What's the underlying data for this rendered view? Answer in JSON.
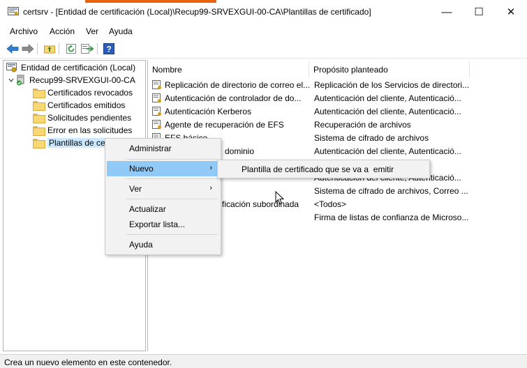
{
  "window": {
    "title": "certsrv - [Entidad de certificación (Local)\\Recup99-SRVEXGUI-00-CA\\Plantillas de certificado]",
    "minimize_glyph": "—",
    "maximize_glyph": "☐",
    "close_glyph": "✕"
  },
  "menubar": {
    "items": [
      "Archivo",
      "Acción",
      "Ver",
      "Ayuda"
    ]
  },
  "toolbar": {
    "buttons": [
      "back-arrow-icon",
      "forward-arrow-icon",
      "up-folder-icon",
      "refresh-icon",
      "export-list-icon",
      "help-icon"
    ],
    "help_glyph": "?"
  },
  "tree": {
    "root": "Entidad de certificación (Local)",
    "ca_node": "Recup99-SRVEXGUI-00-CA",
    "children": [
      "Certificados revocados",
      "Certificados emitidos",
      "Solicitudes pendientes",
      "Error en las solicitudes",
      "Plantillas de cer"
    ]
  },
  "list": {
    "columns": [
      "Nombre",
      "Propósito planteado"
    ],
    "rows": [
      {
        "name": "Replicación de directorio de correo el...",
        "purpose": "Replicación de los Servicios de directori..."
      },
      {
        "name": "Autenticación de controlador de do...",
        "purpose": "Autenticación del cliente, Autenticació..."
      },
      {
        "name": "Autenticación Kerberos",
        "purpose": "Autenticación del cliente, Autenticació..."
      },
      {
        "name": "Agente de recuperación de EFS",
        "purpose": "Recuperación de archivos"
      },
      {
        "name": "EFS básico",
        "purpose": "Sistema de cifrado de archivos"
      },
      {
        "name": "dominio",
        "purpose": "Autenticación del cliente, Autenticació..."
      },
      {
        "name": "",
        "purpose": ""
      },
      {
        "name": "",
        "purpose": "Autenticación del cliente, Autenticació..."
      },
      {
        "name": "",
        "purpose": "Sistema de cifrado de archivos, Correo ..."
      },
      {
        "name": "ficación subordinada",
        "purpose": "<Todos>"
      },
      {
        "name": "",
        "purpose": "Firma de listas de confianza de Microso..."
      }
    ]
  },
  "context_menu": {
    "items": [
      "Administrar",
      "Nuevo",
      "Ver",
      "Actualizar",
      "Exportar lista...",
      "Ayuda"
    ],
    "submenu_arrow": "›"
  },
  "submenu": {
    "item": "Plantilla de certificado que se va a  emitir"
  },
  "status": {
    "text": "Crea un nuevo elemento en este contenedor."
  },
  "colors": {
    "selection": "#cce8ff",
    "menu_highlight": "#91c9f7",
    "title_accent": "#e8620f"
  }
}
